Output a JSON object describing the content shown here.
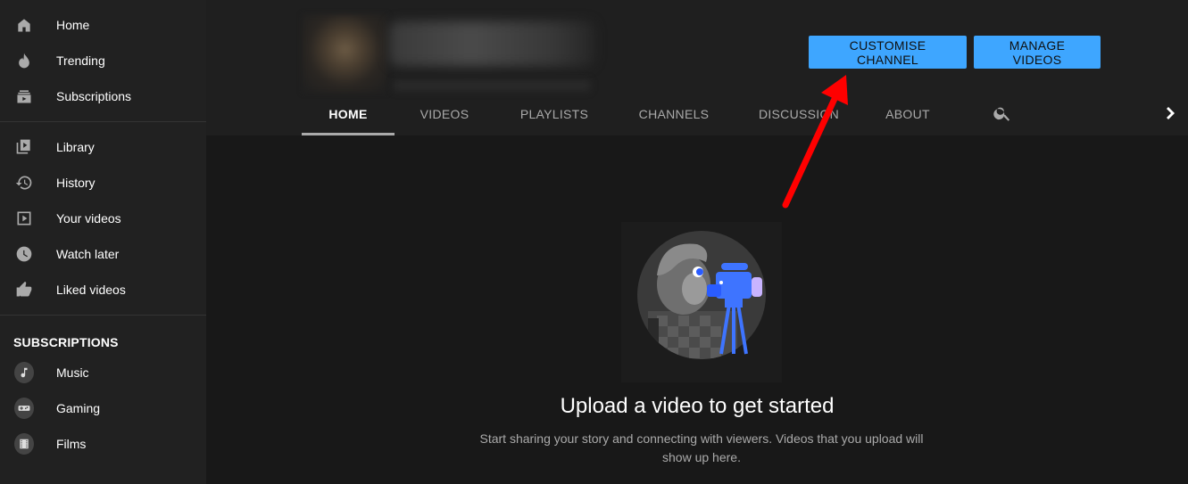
{
  "sidebar": {
    "primary": [
      {
        "label": "Home",
        "icon": "home-icon"
      },
      {
        "label": "Trending",
        "icon": "trending-icon"
      },
      {
        "label": "Subscriptions",
        "icon": "subscriptions-icon"
      }
    ],
    "library": [
      {
        "label": "Library",
        "icon": "library-icon"
      },
      {
        "label": "History",
        "icon": "history-icon"
      },
      {
        "label": "Your videos",
        "icon": "your-videos-icon"
      },
      {
        "label": "Watch later",
        "icon": "watch-later-icon"
      },
      {
        "label": "Liked videos",
        "icon": "like-icon"
      }
    ],
    "subscriptions_heading": "SUBSCRIPTIONS",
    "subscriptions": [
      {
        "label": "Music",
        "icon": "music-icon"
      },
      {
        "label": "Gaming",
        "icon": "gaming-icon"
      },
      {
        "label": "Films",
        "icon": "films-icon"
      }
    ]
  },
  "header": {
    "customise_label": "CUSTOMISE CHANNEL",
    "manage_label": "MANAGE VIDEOS",
    "tabs": [
      {
        "label": "HOME",
        "active": true
      },
      {
        "label": "VIDEOS"
      },
      {
        "label": "PLAYLISTS"
      },
      {
        "label": "CHANNELS"
      },
      {
        "label": "DISCUSSION"
      },
      {
        "label": "ABOUT"
      }
    ]
  },
  "main": {
    "empty_title": "Upload a video to get started",
    "empty_description": "Start sharing your story and connecting with viewers. Videos that you upload will show up here."
  },
  "colors": {
    "accent": "#3ea6ff",
    "sidebar_bg": "#212121",
    "header_bg": "#1f1f1f",
    "page_bg": "#181818",
    "annotation": "#ff0000"
  }
}
